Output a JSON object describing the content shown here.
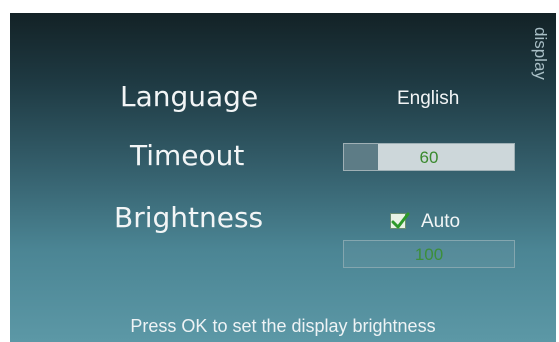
{
  "header": {
    "side_label": "display"
  },
  "settings": {
    "language": {
      "label": "Language",
      "value": "English"
    },
    "timeout": {
      "label": "Timeout",
      "value": "60",
      "level": 0.2
    },
    "brightness": {
      "label": "Brightness",
      "auto_label": "Auto",
      "auto_checked": true,
      "value": "100"
    }
  },
  "footer": {
    "hint": "Press OK to set the display brightness"
  },
  "colors": {
    "value_green": "#3a8a2e",
    "checkbox_green": "#2e9a2a"
  }
}
